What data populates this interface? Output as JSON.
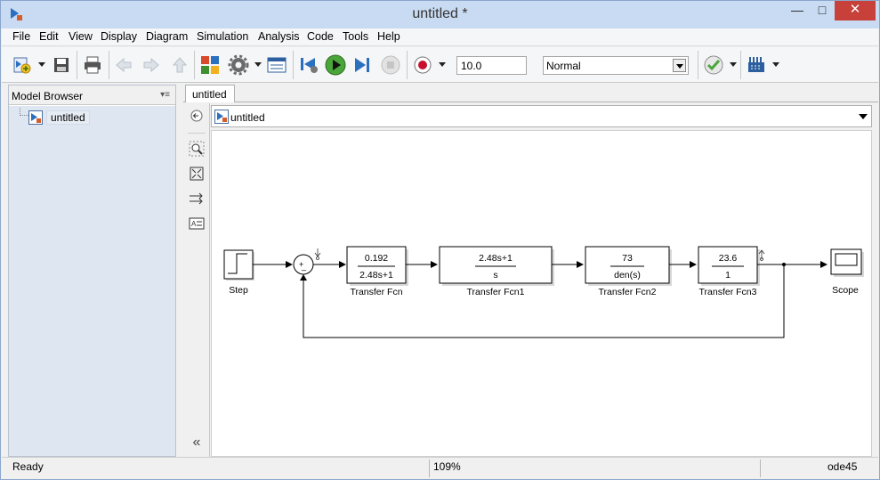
{
  "window": {
    "title": "untitled *"
  },
  "menu": [
    "File",
    "Edit",
    "View",
    "Display",
    "Diagram",
    "Simulation",
    "Analysis",
    "Code",
    "Tools",
    "Help"
  ],
  "toolbar": {
    "stop_time": "10.0",
    "sim_mode": "Normal"
  },
  "browser": {
    "header": "Model Browser",
    "tree_item": "untitled"
  },
  "tab": "untitled",
  "address": "untitled",
  "diagram": {
    "blocks": {
      "step": "Step",
      "tf1": {
        "num": "0.192",
        "den": "2.48s+1",
        "label": "Transfer Fcn"
      },
      "tf2": {
        "num": "2.48s+1",
        "den": "s",
        "label": "Transfer Fcn1"
      },
      "tf3": {
        "num": "73",
        "den": "den(s)",
        "label": "Transfer Fcn2"
      },
      "tf4": {
        "num": "23.6",
        "den": "1",
        "label": "Transfer Fcn3"
      },
      "scope": "Scope",
      "sum": {
        "plus": "+",
        "minus": "_"
      }
    }
  },
  "status": {
    "state": "Ready",
    "zoom": "109%",
    "solver": "ode45"
  },
  "colors": {
    "titlebar": "#c9dbf2",
    "close": "#c7403a",
    "tree_bg": "#dde6f1"
  }
}
